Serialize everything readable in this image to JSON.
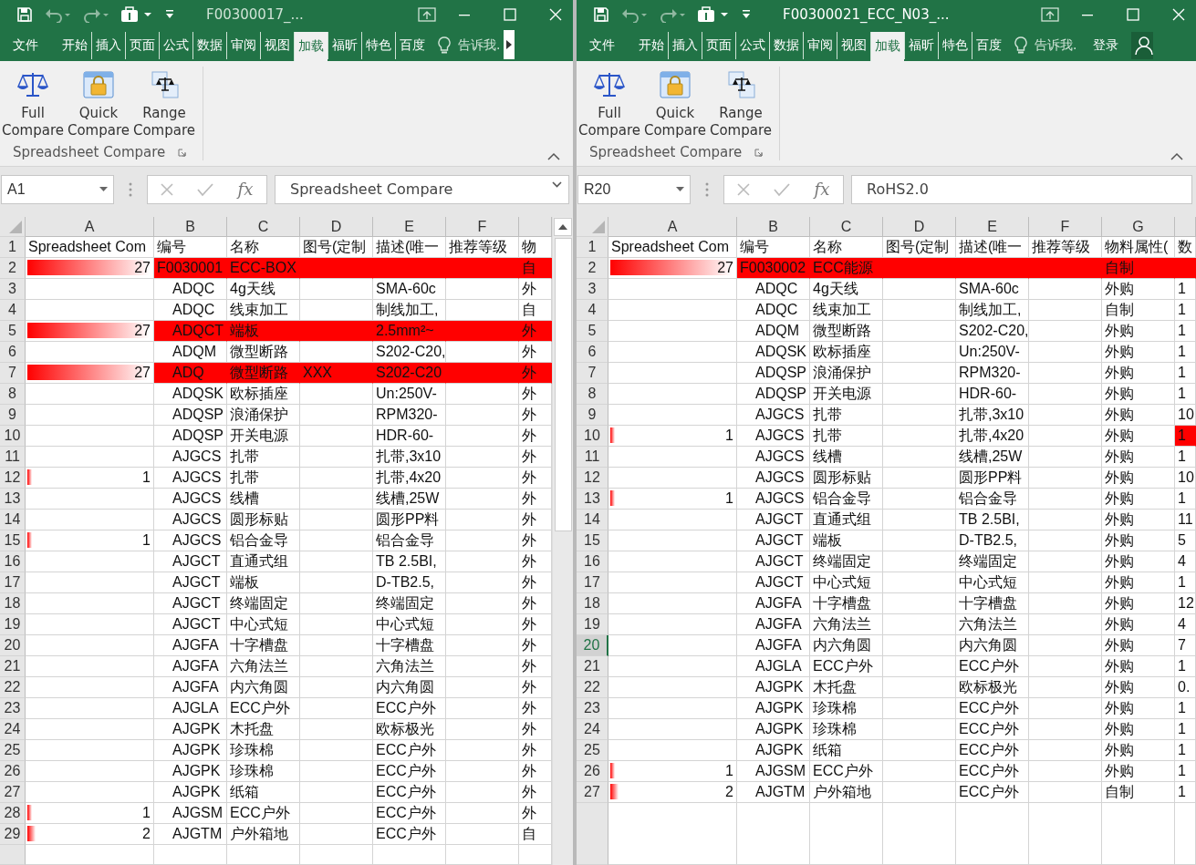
{
  "panes": [
    {
      "title": "F00300017_...",
      "tell_me": "告诉我.",
      "function_label": "fx",
      "name_box": "A1",
      "formula": "Spreadsheet Compare",
      "tabs": [
        {
          "label": "文件",
          "selected": false
        },
        {
          "label": "开始",
          "selected": false
        },
        {
          "label": "插入",
          "selected": false
        },
        {
          "label": "页面",
          "selected": false
        },
        {
          "label": "公式",
          "selected": false
        },
        {
          "label": "数据",
          "selected": false
        },
        {
          "label": "审阅",
          "selected": false
        },
        {
          "label": "视图",
          "selected": false
        },
        {
          "label": "加载",
          "selected": true
        },
        {
          "label": "福昕",
          "selected": false
        },
        {
          "label": "特色",
          "selected": false
        },
        {
          "label": "百度",
          "selected": false
        }
      ],
      "ribbon": {
        "group": "Spreadsheet Compare",
        "buttons": [
          {
            "label": "Full Compare",
            "kind": "scale"
          },
          {
            "label": "Quick Compare",
            "kind": "lock"
          },
          {
            "label": "Range Compare",
            "kind": "range"
          }
        ]
      },
      "columns": [
        "A",
        "B",
        "C",
        "D",
        "E",
        "F"
      ],
      "rows": [
        {
          "number": "1",
          "selected": false,
          "highlight": false,
          "cells": [
            "Spreadsheet Com",
            "编号",
            "名称",
            "图号(定制",
            "描述(唯一",
            "推荐等级",
            "物"
          ]
        },
        {
          "number": "2",
          "selected": false,
          "highlight": true,
          "cells": [
            {
              "text": "27",
              "level": 1
            },
            "F0030001",
            "ECC-BOX",
            null,
            null,
            null,
            "自"
          ]
        },
        {
          "number": "3",
          "selected": false,
          "highlight": false,
          "cells": [
            null,
            "ADQC",
            "4g天线",
            null,
            "SMA-60c",
            null,
            "外"
          ]
        },
        {
          "number": "4",
          "selected": false,
          "highlight": false,
          "cells": [
            null,
            "ADQC",
            "线束加工",
            null,
            "制线加工,",
            null,
            "自"
          ]
        },
        {
          "number": "5",
          "selected": false,
          "highlight": true,
          "cells": [
            {
              "text": "27",
              "level": 1
            },
            "ADQCT",
            "端板",
            null,
            "2.5mm²~",
            null,
            "外"
          ]
        },
        {
          "number": "6",
          "selected": false,
          "highlight": false,
          "cells": [
            null,
            "ADQM",
            "微型断路",
            null,
            "S202-C20,",
            null,
            "外"
          ]
        },
        {
          "number": "7",
          "selected": false,
          "highlight": true,
          "cells": [
            {
              "text": "27",
              "level": 1
            },
            "ADQ",
            "微型断路",
            "XXX",
            "S202-C20",
            null,
            "外"
          ]
        },
        {
          "number": "8",
          "selected": false,
          "highlight": false,
          "cells": [
            null,
            "ADQSK",
            "欧标插座",
            null,
            "Un:250V-",
            null,
            "外"
          ]
        },
        {
          "number": "9",
          "selected": false,
          "highlight": false,
          "cells": [
            null,
            "ADQSP",
            "浪涌保护",
            null,
            "RPM320-",
            null,
            "外"
          ]
        },
        {
          "number": "10",
          "selected": false,
          "highlight": false,
          "cells": [
            null,
            "ADQSP",
            "开关电源",
            null,
            "HDR-60-",
            null,
            "外"
          ]
        },
        {
          "number": "11",
          "selected": false,
          "highlight": false,
          "cells": [
            null,
            "AJGCS",
            "扎带",
            null,
            "扎带,3x10",
            null,
            "外"
          ]
        },
        {
          "number": "12",
          "selected": false,
          "highlight": false,
          "cells": [
            {
              "text": "1",
              "level": 0.04
            },
            "AJGCS",
            "扎带",
            null,
            "扎带,4x20",
            null,
            "外"
          ]
        },
        {
          "number": "13",
          "selected": false,
          "highlight": false,
          "cells": [
            null,
            "AJGCS",
            "线槽",
            null,
            "线槽,25W",
            null,
            "外"
          ]
        },
        {
          "number": "14",
          "selected": false,
          "highlight": false,
          "cells": [
            null,
            "AJGCS",
            "圆形标贴",
            null,
            "圆形PP料",
            null,
            "外"
          ]
        },
        {
          "number": "15",
          "selected": false,
          "highlight": false,
          "cells": [
            {
              "text": "1",
              "level": 0.04
            },
            "AJGCS",
            "铝合金导",
            null,
            "铝合金导",
            null,
            "外"
          ]
        },
        {
          "number": "16",
          "selected": false,
          "highlight": false,
          "cells": [
            null,
            "AJGCT",
            "直通式组",
            null,
            "TB 2.5BI,",
            null,
            "外"
          ]
        },
        {
          "number": "17",
          "selected": false,
          "highlight": false,
          "cells": [
            null,
            "AJGCT",
            "端板",
            null,
            "D-TB2.5,",
            null,
            "外"
          ]
        },
        {
          "number": "18",
          "selected": false,
          "highlight": false,
          "cells": [
            null,
            "AJGCT",
            "终端固定",
            null,
            "终端固定",
            null,
            "外"
          ]
        },
        {
          "number": "19",
          "selected": false,
          "highlight": false,
          "cells": [
            null,
            "AJGCT",
            "中心式短",
            null,
            "中心式短",
            null,
            "外"
          ]
        },
        {
          "number": "20",
          "selected": false,
          "highlight": false,
          "cells": [
            null,
            "AJGFA",
            "十字槽盘",
            null,
            "十字槽盘",
            null,
            "外"
          ]
        },
        {
          "number": "21",
          "selected": false,
          "highlight": false,
          "cells": [
            null,
            "AJGFA",
            "六角法兰",
            null,
            "六角法兰",
            null,
            "外"
          ]
        },
        {
          "number": "22",
          "selected": false,
          "highlight": false,
          "cells": [
            null,
            "AJGFA",
            "内六角圆",
            null,
            "内六角圆",
            null,
            "外"
          ]
        },
        {
          "number": "23",
          "selected": false,
          "highlight": false,
          "cells": [
            null,
            "AJGLA",
            "ECC户外",
            null,
            "ECC户外",
            null,
            "外"
          ]
        },
        {
          "number": "24",
          "selected": false,
          "highlight": false,
          "cells": [
            null,
            "AJGPK",
            "木托盘",
            null,
            "欧标极光",
            null,
            "外"
          ]
        },
        {
          "number": "25",
          "selected": false,
          "highlight": false,
          "cells": [
            null,
            "AJGPK",
            "珍珠棉",
            null,
            "ECC户外",
            null,
            "外"
          ]
        },
        {
          "number": "26",
          "selected": false,
          "highlight": false,
          "cells": [
            null,
            "AJGPK",
            "珍珠棉",
            null,
            "ECC户外",
            null,
            "外"
          ]
        },
        {
          "number": "27",
          "selected": false,
          "highlight": false,
          "cells": [
            null,
            "AJGPK",
            "纸箱",
            null,
            "ECC户外",
            null,
            "外"
          ]
        },
        {
          "number": "28",
          "selected": false,
          "highlight": false,
          "cells": [
            {
              "text": "1",
              "level": 0.04
            },
            "AJGSM",
            "ECC户外",
            null,
            "ECC户外",
            null,
            "外"
          ]
        },
        {
          "number": "29",
          "selected": false,
          "highlight": false,
          "cells": [
            {
              "text": "2",
              "level": 0.07
            },
            "AJGTM",
            "户外箱地",
            null,
            "ECC户外",
            null,
            "自"
          ]
        }
      ]
    },
    {
      "title": "F00300021_ECC_N03_...",
      "tell_me": "告诉我.",
      "sign_in": "登录",
      "function_label": "fx",
      "name_box": "R20",
      "formula": "RoHS2.0",
      "tabs": [
        {
          "label": "文件",
          "selected": false
        },
        {
          "label": "开始",
          "selected": false
        },
        {
          "label": "插入",
          "selected": false
        },
        {
          "label": "页面",
          "selected": false
        },
        {
          "label": "公式",
          "selected": false
        },
        {
          "label": "数据",
          "selected": false
        },
        {
          "label": "审阅",
          "selected": false
        },
        {
          "label": "视图",
          "selected": false
        },
        {
          "label": "加载",
          "selected": true
        },
        {
          "label": "福昕",
          "selected": false
        },
        {
          "label": "特色",
          "selected": false
        },
        {
          "label": "百度",
          "selected": false
        }
      ],
      "ribbon": {
        "group": "Spreadsheet Compare",
        "buttons": [
          {
            "label": "Full Compare",
            "kind": "scale"
          },
          {
            "label": "Quick Compare",
            "kind": "lock"
          },
          {
            "label": "Range Compare",
            "kind": "range"
          }
        ]
      },
      "columns": [
        "A",
        "B",
        "C",
        "D",
        "E",
        "F",
        "G"
      ],
      "rows": [
        {
          "number": "1",
          "selected": false,
          "highlight": false,
          "cells": [
            "Spreadsheet Com",
            "编号",
            "名称",
            "图号(定制",
            "描述(唯一",
            "推荐等级",
            "物料属性(",
            "数"
          ]
        },
        {
          "number": "2",
          "selected": false,
          "highlight": true,
          "cells": [
            {
              "text": "27",
              "level": 1
            },
            "F0030002",
            "ECC能源",
            null,
            null,
            null,
            "自制",
            null
          ]
        },
        {
          "number": "3",
          "selected": false,
          "highlight": false,
          "cells": [
            null,
            "ADQC",
            "4g天线",
            null,
            "SMA-60c",
            null,
            "外购",
            "1"
          ]
        },
        {
          "number": "4",
          "selected": false,
          "highlight": false,
          "cells": [
            null,
            "ADQC",
            "线束加工",
            null,
            "制线加工,",
            null,
            "自制",
            "1"
          ]
        },
        {
          "number": "5",
          "selected": false,
          "highlight": false,
          "cells": [
            null,
            "ADQM",
            "微型断路",
            null,
            "S202-C20,",
            null,
            "外购",
            "1"
          ]
        },
        {
          "number": "6",
          "selected": false,
          "highlight": false,
          "cells": [
            null,
            "ADQSK",
            "欧标插座",
            null,
            "Un:250V-",
            null,
            "外购",
            "1"
          ]
        },
        {
          "number": "7",
          "selected": false,
          "highlight": false,
          "cells": [
            null,
            "ADQSP",
            "浪涌保护",
            null,
            "RPM320-",
            null,
            "外购",
            "1"
          ]
        },
        {
          "number": "8",
          "selected": false,
          "highlight": false,
          "cells": [
            null,
            "ADQSP",
            "开关电源",
            null,
            "HDR-60-",
            null,
            "外购",
            "1"
          ]
        },
        {
          "number": "9",
          "selected": false,
          "highlight": false,
          "cells": [
            null,
            "AJGCS",
            "扎带",
            null,
            "扎带,3x10",
            null,
            "外购",
            "10"
          ]
        },
        {
          "number": "10",
          "selected": false,
          "highlight": false,
          "cells": [
            {
              "text": "1",
              "level": 0.04
            },
            "AJGCS",
            "扎带",
            null,
            "扎带,4x20",
            null,
            "外购",
            {
              "text": "1",
              "flagged": true
            }
          ]
        },
        {
          "number": "11",
          "selected": false,
          "highlight": false,
          "cells": [
            null,
            "AJGCS",
            "线槽",
            null,
            "线槽,25W",
            null,
            "外购",
            "1"
          ]
        },
        {
          "number": "12",
          "selected": false,
          "highlight": false,
          "cells": [
            null,
            "AJGCS",
            "圆形标贴",
            null,
            "圆形PP料",
            null,
            "外购",
            "10"
          ]
        },
        {
          "number": "13",
          "selected": false,
          "highlight": false,
          "cells": [
            {
              "text": "1",
              "level": 0.04
            },
            "AJGCS",
            "铝合金导",
            null,
            "铝合金导",
            null,
            "外购",
            "1"
          ]
        },
        {
          "number": "14",
          "selected": false,
          "highlight": false,
          "cells": [
            null,
            "AJGCT",
            "直通式组",
            null,
            "TB 2.5BI,",
            null,
            "外购",
            "11"
          ]
        },
        {
          "number": "15",
          "selected": false,
          "highlight": false,
          "cells": [
            null,
            "AJGCT",
            "端板",
            null,
            "D-TB2.5,",
            null,
            "外购",
            "5"
          ]
        },
        {
          "number": "16",
          "selected": false,
          "highlight": false,
          "cells": [
            null,
            "AJGCT",
            "终端固定",
            null,
            "终端固定",
            null,
            "外购",
            "4"
          ]
        },
        {
          "number": "17",
          "selected": false,
          "highlight": false,
          "cells": [
            null,
            "AJGCT",
            "中心式短",
            null,
            "中心式短",
            null,
            "外购",
            "1"
          ]
        },
        {
          "number": "18",
          "selected": false,
          "highlight": false,
          "cells": [
            null,
            "AJGFA",
            "十字槽盘",
            null,
            "十字槽盘",
            null,
            "外购",
            "12"
          ]
        },
        {
          "number": "19",
          "selected": false,
          "highlight": false,
          "cells": [
            null,
            "AJGFA",
            "六角法兰",
            null,
            "六角法兰",
            null,
            "外购",
            "4"
          ]
        },
        {
          "number": "20",
          "selected": true,
          "highlight": false,
          "cells": [
            null,
            "AJGFA",
            "内六角圆",
            null,
            "内六角圆",
            null,
            "外购",
            "7"
          ]
        },
        {
          "number": "21",
          "selected": false,
          "highlight": false,
          "cells": [
            null,
            "AJGLA",
            "ECC户外",
            null,
            "ECC户外",
            null,
            "外购",
            "1"
          ]
        },
        {
          "number": "22",
          "selected": false,
          "highlight": false,
          "cells": [
            null,
            "AJGPK",
            "木托盘",
            null,
            "欧标极光",
            null,
            "外购",
            "0."
          ]
        },
        {
          "number": "23",
          "selected": false,
          "highlight": false,
          "cells": [
            null,
            "AJGPK",
            "珍珠棉",
            null,
            "ECC户外",
            null,
            "外购",
            "1"
          ]
        },
        {
          "number": "24",
          "selected": false,
          "highlight": false,
          "cells": [
            null,
            "AJGPK",
            "珍珠棉",
            null,
            "ECC户外",
            null,
            "外购",
            "1"
          ]
        },
        {
          "number": "25",
          "selected": false,
          "highlight": false,
          "cells": [
            null,
            "AJGPK",
            "纸箱",
            null,
            "ECC户外",
            null,
            "外购",
            "1"
          ]
        },
        {
          "number": "26",
          "selected": false,
          "highlight": false,
          "cells": [
            {
              "text": "1",
              "level": 0.04
            },
            "AJGSM",
            "ECC户外",
            null,
            "ECC户外",
            null,
            "外购",
            "1"
          ]
        },
        {
          "number": "27",
          "selected": false,
          "highlight": false,
          "cells": [
            {
              "text": "2",
              "level": 0.07
            },
            "AJGTM",
            "户外箱地",
            null,
            "ECC户外",
            null,
            "自制",
            "1"
          ]
        }
      ]
    }
  ]
}
